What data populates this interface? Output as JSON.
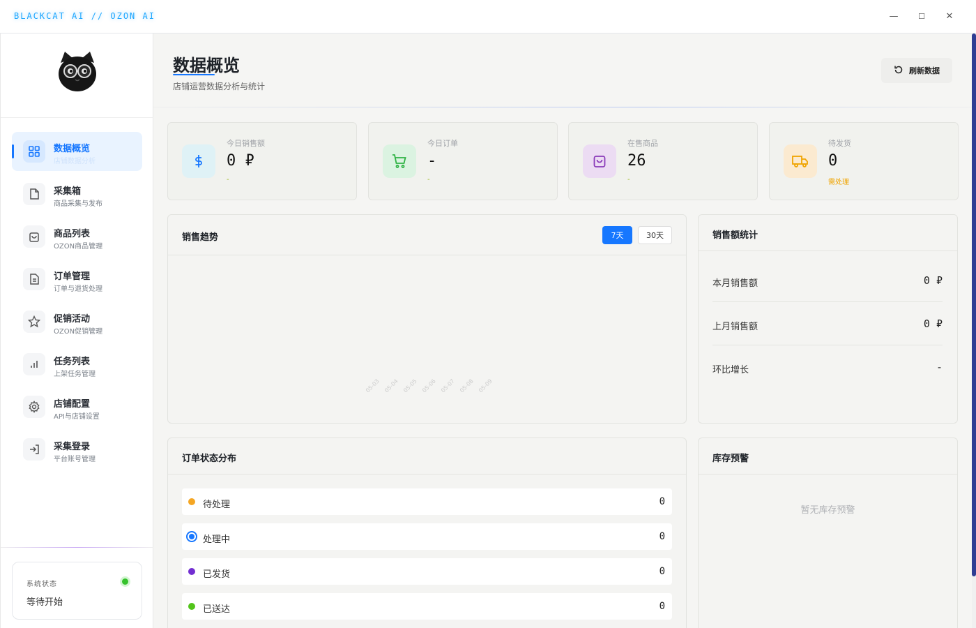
{
  "window": {
    "brand": "BLACKCAT AI // OZON AI",
    "minimize": "—",
    "maximize": "☐",
    "close": "✕"
  },
  "sidebar": {
    "items": [
      {
        "label": "数据概览",
        "sub": "店铺数据分析",
        "icon": "grid-icon",
        "active": true
      },
      {
        "label": "采集箱",
        "sub": "商品采集与发布",
        "icon": "file-icon"
      },
      {
        "label": "商品列表",
        "sub": "OZON商品管理",
        "icon": "bag-icon"
      },
      {
        "label": "订单管理",
        "sub": "订单与退货处理",
        "icon": "document-icon"
      },
      {
        "label": "促销活动",
        "sub": "OZON促销管理",
        "icon": "star-icon"
      },
      {
        "label": "任务列表",
        "sub": "上架任务管理",
        "icon": "bar-chart-icon"
      },
      {
        "label": "店铺配置",
        "sub": "API与店铺设置",
        "icon": "gear-icon"
      },
      {
        "label": "采集登录",
        "sub": "平台账号管理",
        "icon": "login-icon"
      }
    ],
    "status": {
      "title": "系统状态",
      "text": "等待开始",
      "color": "#35c22b"
    }
  },
  "header": {
    "title": "数据概览",
    "subtitle": "店铺运营数据分析与统计",
    "refresh_label": "刷新数据"
  },
  "stats": [
    {
      "label": "今日销售额",
      "value": "0 ₽",
      "note": "-",
      "icon": "dollar-icon",
      "bg": "#dff2f6",
      "color": "#1677ff"
    },
    {
      "label": "今日订单",
      "value": "-",
      "note": "-",
      "icon": "cart-icon",
      "bg": "#dbf3e1",
      "color": "#2fb344"
    },
    {
      "label": "在售商品",
      "value": "26",
      "note": "-",
      "icon": "bag-icon",
      "bg": "#ecdcf3",
      "color": "#8a3ab9"
    },
    {
      "label": "待发货",
      "value": "0",
      "note": "需处理",
      "icon": "truck-icon",
      "bg": "#fbead0",
      "color": "#f0a400"
    }
  ],
  "trend": {
    "title": "销售趋势",
    "range_7": "7天",
    "range_30": "30天",
    "selected_range": "7天"
  },
  "chart_data": {
    "type": "line",
    "categories": [
      "05-03",
      "05-04",
      "05-05",
      "05-06",
      "05-07",
      "05-08",
      "05-09"
    ],
    "series": []
  },
  "sales_stats": {
    "title": "销售额统计",
    "rows": [
      {
        "label": "本月销售额",
        "value": "0 ₽"
      },
      {
        "label": "上月销售额",
        "value": "0 ₽"
      },
      {
        "label": "环比增长",
        "value": "-"
      }
    ]
  },
  "order_status": {
    "title": "订单状态分布",
    "rows": [
      {
        "label": "待处理",
        "count": "0",
        "color": "#f5a623"
      },
      {
        "label": "处理中",
        "count": "0",
        "color": "#1677ff"
      },
      {
        "label": "已发货",
        "count": "0",
        "color": "#722ed1"
      },
      {
        "label": "已送达",
        "count": "0",
        "color": "#52c41a"
      }
    ]
  },
  "inventory": {
    "title": "库存预警",
    "empty": "暂无库存预警"
  }
}
